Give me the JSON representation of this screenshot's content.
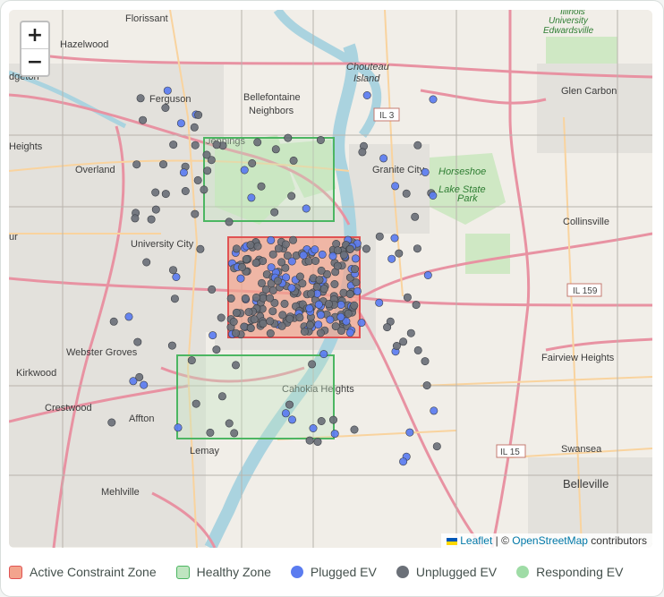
{
  "map": {
    "zoom_in_label": "+",
    "zoom_out_label": "−",
    "attribution": {
      "leaflet": "Leaflet",
      "separator": " | © ",
      "osm": "OpenStreetMap",
      "contributors": " contributors"
    },
    "place_labels": {
      "florissant": "Florissant",
      "hazelwood": "Hazelwood",
      "bridgeton": "dgeton",
      "ferguson": "Ferguson",
      "bellefontaine": "Bellefontaine",
      "bellefontaine2": "Neighbors",
      "jennings": "Jennings",
      "heights": "Heights",
      "overland": "Overland",
      "university_city": "University City",
      "ur": "ur",
      "webster_groves": "Webster Groves",
      "kirkwood": "Kirkwood",
      "crestwood": "Crestwood",
      "affton": "Affton",
      "lemay": "Lemay",
      "mehlville": "Mehlville",
      "granite_city": "Granite City",
      "chouteau": "Chouteau",
      "chouteau2": "Island",
      "horseshoe": "Horseshoe",
      "horseshoe2": "Lake State",
      "horseshoe3": "Park",
      "collinsville": "Collinsville",
      "glen_carbon": "Glen Carbon",
      "siue1": "Illinois",
      "siue2": "University",
      "siue3": "Edwardsville",
      "fairview": "Fairview Heights",
      "cahokia": "Cahokia Heights",
      "swansea": "Swansea",
      "belleville": "Belleville",
      "il3": "IL 3",
      "il159": "IL 159",
      "il15": "IL 15"
    }
  },
  "zones": {
    "active": {
      "color": "#e05353",
      "fill": "#f3a48d"
    },
    "healthy": {
      "color": "#4cb662",
      "fill": "#bfe5c0"
    }
  },
  "ev": {
    "plugged_color": "#5b7cf0",
    "unplugged_color": "#6b7078",
    "responding_color": "#9fdca6"
  },
  "legend": {
    "active_zone": "Active Constraint Zone",
    "healthy_zone": "Healthy Zone",
    "plugged_ev": "Plugged EV",
    "unplugged_ev": "Unplugged EV",
    "responding_ev": "Responding EV"
  }
}
